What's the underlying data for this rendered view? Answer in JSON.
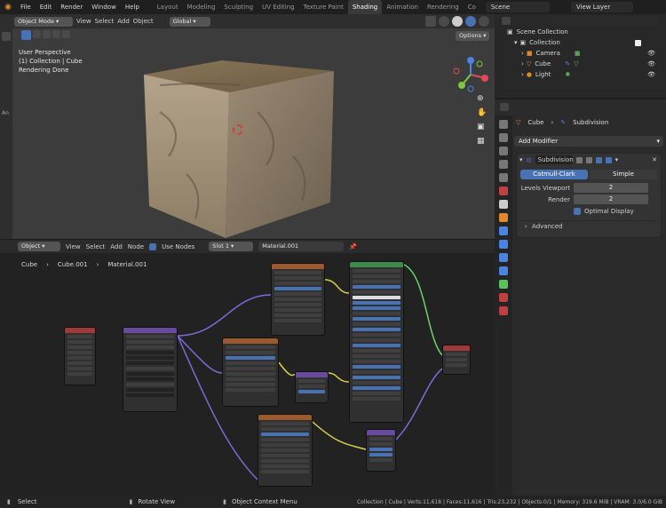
{
  "topbar": {
    "menus": [
      "File",
      "Edit",
      "Render",
      "Window",
      "Help"
    ],
    "workspaces": [
      "Layout",
      "Modeling",
      "Sculpting",
      "UV Editing",
      "Texture Paint",
      "Shading",
      "Animation",
      "Rendering",
      "Co"
    ],
    "active_workspace": "Shading",
    "scene": "Scene",
    "view_layer": "View Layer"
  },
  "viewport": {
    "mode": "Object Mode",
    "menus": [
      "View",
      "Select",
      "Add",
      "Object"
    ],
    "orientation": "Global",
    "options": "Options",
    "overlay_lines": [
      "User Perspective",
      "(1) Collection | Cube",
      "Rendering Done"
    ],
    "left_label": "An"
  },
  "node_editor": {
    "type": "Object",
    "menus": [
      "View",
      "Select",
      "Add",
      "Node"
    ],
    "use_nodes": "Use Nodes",
    "slot": "Slot 1",
    "material": "Material.001",
    "breadcrumb": [
      "Cube",
      "Cube.001",
      "Material.001"
    ]
  },
  "outliner": {
    "title": "Scene Collection",
    "items": [
      {
        "name": "Collection"
      },
      {
        "name": "Camera"
      },
      {
        "name": "Cube"
      },
      {
        "name": "Light"
      }
    ]
  },
  "properties": {
    "breadcrumb_object": "Cube",
    "breadcrumb_modifier": "Subdivision",
    "add_modifier": "Add Modifier",
    "modifier_name": "Subdivision",
    "type_options": [
      "Catmull-Clark",
      "Simple"
    ],
    "levels_viewport_label": "Levels Viewport",
    "levels_viewport": "2",
    "render_label": "Render",
    "render": "2",
    "optimal_display": "Optimal Display",
    "advanced": "Advanced"
  },
  "status": {
    "left": "Select",
    "middle1": "Rotate View",
    "middle2": "Object Context Menu",
    "stats": "Collection | Cube | Verts:11,618 | Faces:11,616 | Tris:23,232 | Objects:0/1 | Memory: 319.6 MiB | VRAM: 3.0/6.0 GiB"
  },
  "colors": {
    "accent": "#4772b3",
    "node_green": "#3e8a4a",
    "node_orange": "#9a5a2e",
    "node_purple": "#6a4a9e",
    "node_red": "#9e3a3a",
    "link_yellow": "#d8d04a",
    "link_purple": "#7a6ad6",
    "link_green": "#6ad66a"
  }
}
